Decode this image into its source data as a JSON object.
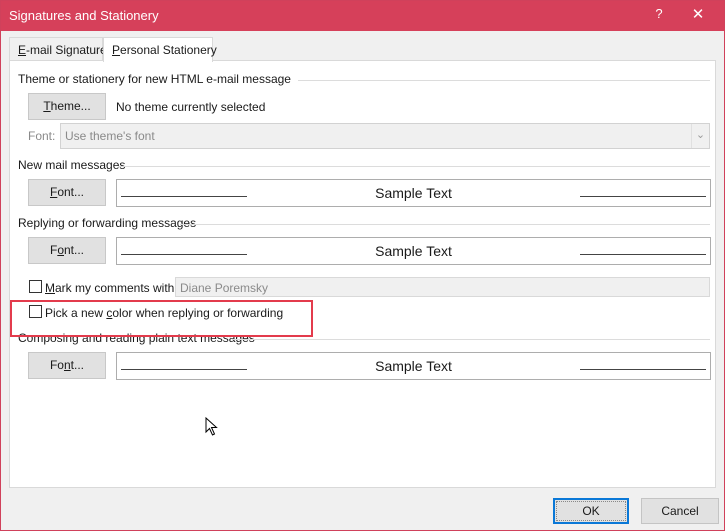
{
  "window": {
    "title": "Signatures and Stationery",
    "help_glyph": "?",
    "close_glyph": "✕"
  },
  "tabs": [
    {
      "label_prefix": "",
      "label_accel": "E",
      "label_rest": "-mail Signature"
    },
    {
      "label_prefix": "",
      "label_accel": "P",
      "label_rest": "ersonal Stationery"
    }
  ],
  "theme_section": {
    "label": "Theme or stationery for new HTML e-mail message",
    "button_accel": "T",
    "button_rest": "heme...",
    "status": "No theme currently selected",
    "font_label": "Font:",
    "font_value": "Use theme's font"
  },
  "new_mail": {
    "label": "New mail messages",
    "font_button_pre": "",
    "font_button_accel": "F",
    "font_button_rest": "ont...",
    "sample": "Sample Text"
  },
  "reply": {
    "label": "Replying or forwarding messages",
    "font_button_pre": "F",
    "font_button_accel": "o",
    "font_button_rest": "nt...",
    "sample": "Sample Text",
    "mark_label_accel": "M",
    "mark_label_rest": "ark my comments with:",
    "mark_value": "Diane Poremsky",
    "pick_color_pre": "Pick a new ",
    "pick_color_accel": "c",
    "pick_color_rest": "olor when replying or forwarding"
  },
  "plain_text": {
    "label": "Composing and reading plain text messages",
    "font_button_pre": "Fo",
    "font_button_accel": "n",
    "font_button_rest": "t...",
    "sample": "Sample Text"
  },
  "footer": {
    "ok": "OK",
    "cancel": "Cancel"
  },
  "colors": {
    "titlebar": "#d6405a",
    "highlight": "#e33b4c",
    "default_button_border": "#0a78d7"
  }
}
